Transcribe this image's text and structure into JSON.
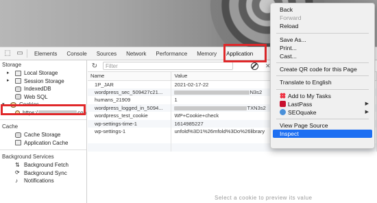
{
  "devtools": {
    "tabs": [
      "Elements",
      "Console",
      "Sources",
      "Network",
      "Performance",
      "Memory",
      "Application"
    ],
    "active_tab": "Application"
  },
  "sidebar": {
    "storage_header": "Storage",
    "storage_items": [
      "Local Storage",
      "Session Storage",
      "IndexedDB",
      "Web SQL",
      "Cookies"
    ],
    "cookie_site_prefix": "https:/",
    "cookie_site_suffix": "con",
    "cache_header": "Cache",
    "cache_items": [
      "Cache Storage",
      "Application Cache"
    ],
    "bg_header": "Background Services",
    "bg_items": [
      "Background Fetch",
      "Background Sync",
      "Notifications"
    ]
  },
  "toolbar": {
    "filter_placeholder": "Filter"
  },
  "table": {
    "headers": [
      "Name",
      "Value"
    ],
    "rows": [
      {
        "name": "1P_JAR",
        "value": "2021-02-17-22"
      },
      {
        "name": "wordpress_sec_509427c21...",
        "value": "N3s2"
      },
      {
        "name": "humans_21909",
        "value": "1"
      },
      {
        "name": "wordpress_logged_in_5094...",
        "value": "TXN3s2"
      },
      {
        "name": "wordpress_test_cookie",
        "value": "WP+Cookie+check"
      },
      {
        "name": "wp-settings-time-1",
        "value": "1614985227"
      },
      {
        "name": "wp-settings-1",
        "value": "unfold%3D1%26mfold%3Do%26library"
      }
    ]
  },
  "bottom_text": "Select a cookie to preview its value",
  "context_menu": {
    "back": "Back",
    "forward": "Forward",
    "reload": "Reload",
    "save_as": "Save As...",
    "print": "Print...",
    "cast": "Cast...",
    "qr": "Create QR code for this Page",
    "translate": "Translate to English",
    "add_tasks": "Add to My Tasks",
    "lastpass": "LastPass",
    "seoquake": "SEOquake",
    "view_source": "View Page Source",
    "inspect": "Inspect"
  },
  "colors": {
    "highlight": "#e0282a",
    "menu_selected": "#1d6ff2"
  }
}
